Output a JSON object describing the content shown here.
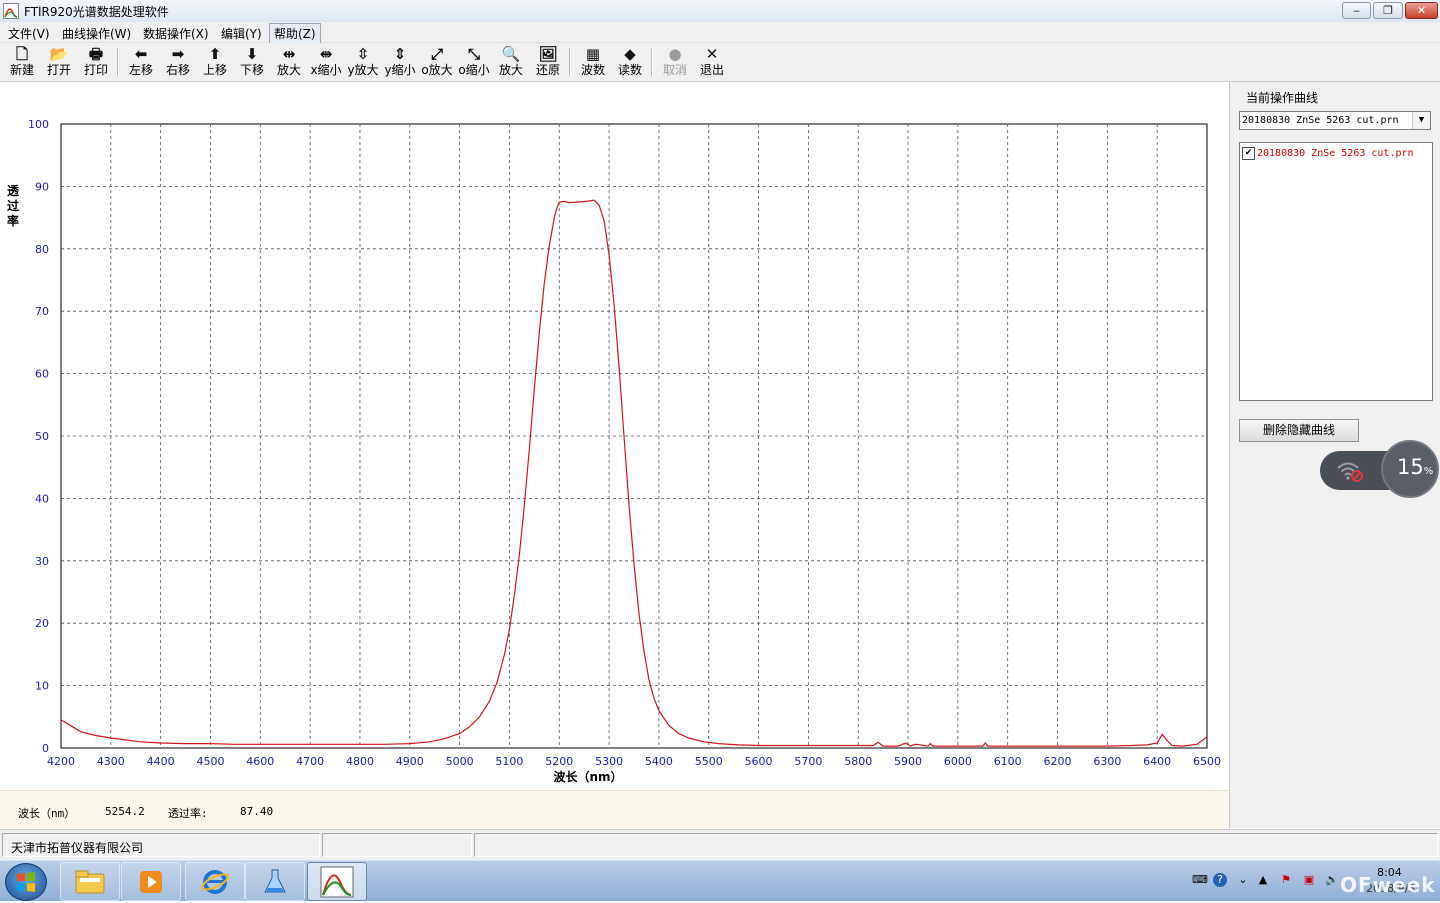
{
  "window": {
    "title": "FTIR920光谱数据处理软件",
    "controls": {
      "minimize": "‒",
      "maximize": "❐",
      "close": "✕"
    }
  },
  "menu": [
    "文件(V)",
    "曲线操作(W)",
    "数据操作(X)",
    "编辑(Y)",
    "帮助(Z)"
  ],
  "toolbar": [
    {
      "label": "新建",
      "icon": "new-file-icon",
      "glyph": "🗋"
    },
    {
      "label": "打开",
      "icon": "open-folder-icon",
      "glyph": "📂"
    },
    {
      "label": "打印",
      "icon": "printer-icon",
      "glyph": "🖶"
    },
    {
      "label": "左移",
      "icon": "arrow-left-icon",
      "glyph": "⬅"
    },
    {
      "label": "右移",
      "icon": "arrow-right-icon",
      "glyph": "➡"
    },
    {
      "label": "上移",
      "icon": "arrow-up-icon",
      "glyph": "⬆"
    },
    {
      "label": "下移",
      "icon": "arrow-down-icon",
      "glyph": "⬇"
    },
    {
      "label": "放大",
      "icon": "x-expand-icon",
      "glyph": "⇹"
    },
    {
      "label": "x缩小",
      "icon": "x-shrink-icon",
      "glyph": "⇼"
    },
    {
      "label": "y放大",
      "icon": "y-expand-icon",
      "glyph": "⇳"
    },
    {
      "label": "y缩小",
      "icon": "y-shrink-icon",
      "glyph": "⇕"
    },
    {
      "label": "o放大",
      "icon": "zoom-out-all-icon",
      "glyph": "⤢"
    },
    {
      "label": "o缩小",
      "icon": "zoom-in-all-icon",
      "glyph": "⤡"
    },
    {
      "label": "放大",
      "icon": "magnifier-icon",
      "glyph": "🔍"
    },
    {
      "label": "还原",
      "icon": "restore-icon",
      "glyph": "🖼"
    },
    {
      "label": "波数",
      "icon": "wavenumber-icon",
      "glyph": "▦"
    },
    {
      "label": "读数",
      "icon": "read-value-icon",
      "glyph": "◆"
    },
    {
      "label": "取消",
      "icon": "cancel-circle-icon",
      "glyph": "●",
      "disabled": true
    },
    {
      "label": "退出",
      "icon": "exit-x-icon",
      "glyph": "✕"
    }
  ],
  "chart_data": {
    "type": "line",
    "xlabel": "波长（nm）",
    "ylabel": "透过率",
    "xlim": [
      4200,
      6500
    ],
    "ylim": [
      0,
      100
    ],
    "x_ticks": [
      4200,
      4300,
      4400,
      4500,
      4600,
      4700,
      4800,
      4900,
      5000,
      5100,
      5200,
      5300,
      5400,
      5500,
      5600,
      5700,
      5800,
      5900,
      6000,
      6100,
      6200,
      6300,
      6400,
      6500
    ],
    "y_ticks": [
      0,
      10,
      20,
      30,
      40,
      50,
      60,
      70,
      80,
      90,
      100
    ],
    "grid": true,
    "colors": {
      "line": "#d0141c",
      "tick_text": "#1a1ab8",
      "axis_label": "#000000"
    },
    "series": [
      {
        "name": "20180830 ZnSe 5263 cut.prn",
        "x": [
          4200,
          4215,
          4240,
          4270,
          4300,
          4330,
          4360,
          4400,
          4450,
          4500,
          4550,
          4600,
          4650,
          4700,
          4750,
          4800,
          4850,
          4900,
          4940,
          4970,
          5000,
          5020,
          5040,
          5060,
          5075,
          5090,
          5100,
          5110,
          5120,
          5130,
          5140,
          5150,
          5160,
          5170,
          5180,
          5190,
          5195,
          5200,
          5210,
          5220,
          5240,
          5255,
          5270,
          5280,
          5290,
          5300,
          5310,
          5320,
          5330,
          5340,
          5350,
          5360,
          5370,
          5380,
          5390,
          5400,
          5420,
          5440,
          5460,
          5490,
          5520,
          5560,
          5600,
          5650,
          5700,
          5750,
          5800,
          5830,
          5840,
          5850,
          5880,
          5895,
          5905,
          5915,
          5940,
          5945,
          5950,
          5980,
          6000,
          6050,
          6055,
          6060,
          6100,
          6150,
          6200,
          6250,
          6300,
          6350,
          6380,
          6400,
          6410,
          6420,
          6430,
          6450,
          6480,
          6500
        ],
        "y": [
          4.5,
          3.8,
          2.6,
          2.0,
          1.6,
          1.3,
          1.0,
          0.8,
          0.7,
          0.7,
          0.6,
          0.6,
          0.6,
          0.6,
          0.6,
          0.6,
          0.6,
          0.7,
          1.0,
          1.5,
          2.3,
          3.4,
          5.0,
          7.5,
          10.5,
          15.0,
          19.0,
          24.5,
          31.0,
          39.0,
          48.0,
          57.5,
          66.5,
          74.5,
          80.5,
          85.0,
          86.5,
          87.5,
          87.6,
          87.4,
          87.5,
          87.6,
          87.8,
          87.0,
          84.5,
          79.0,
          71.0,
          61.0,
          50.0,
          39.0,
          29.5,
          21.5,
          15.5,
          11.0,
          8.0,
          6.0,
          3.6,
          2.3,
          1.6,
          1.0,
          0.7,
          0.5,
          0.4,
          0.4,
          0.4,
          0.4,
          0.4,
          0.4,
          0.9,
          0.3,
          0.3,
          0.8,
          0.3,
          0.6,
          0.3,
          0.7,
          0.3,
          0.3,
          0.3,
          0.3,
          0.8,
          0.3,
          0.3,
          0.3,
          0.3,
          0.3,
          0.3,
          0.4,
          0.5,
          0.8,
          2.2,
          1.2,
          0.4,
          0.3,
          0.6,
          1.8
        ]
      }
    ]
  },
  "readout": {
    "wavelength_label": "波长（nm）",
    "wavelength_value": "5254.2",
    "trans_label": "透过率:",
    "trans_value": "87.40"
  },
  "right_panel": {
    "title": "当前操作曲线",
    "selected_curve": "20180830 ZnSe 5263 cut.prn",
    "curves": [
      {
        "name": "20180830 ZnSe 5263 cut.prn",
        "checked": true,
        "color": "#d10000"
      }
    ],
    "delete_button": "删除隐藏曲线"
  },
  "net_widget": {
    "percent": "15",
    "unit": "%"
  },
  "status": {
    "company": "天津市拓普仪器有限公司"
  },
  "taskbar": {
    "apps": [
      "file-explorer-icon",
      "media-player-icon",
      "internet-explorer-icon",
      "flask-app-icon",
      "spectrum-app-icon"
    ],
    "time": "8:04",
    "date": "2018/9/3",
    "watermark": "OFweek"
  }
}
